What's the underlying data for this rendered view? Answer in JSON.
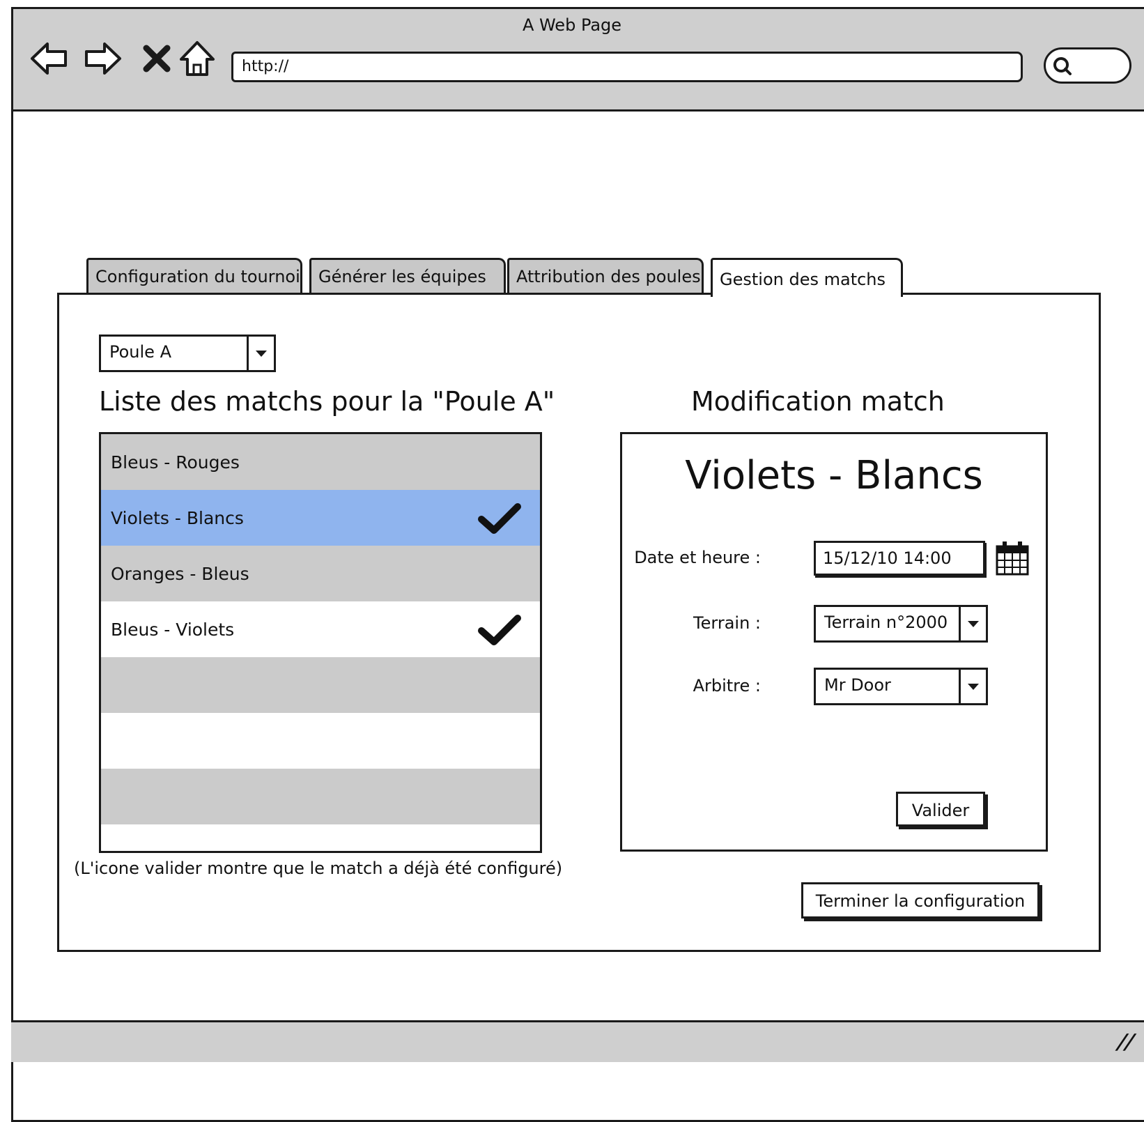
{
  "window": {
    "title": "A Web Page"
  },
  "browser": {
    "url": "http://"
  },
  "tabs": [
    {
      "label": "Configuration du tournoi",
      "active": false
    },
    {
      "label": "Générer les équipes",
      "active": false
    },
    {
      "label": "Attribution des poules",
      "active": false
    },
    {
      "label": "Gestion des matchs",
      "active": true
    }
  ],
  "pool_select": {
    "value": "Poule A"
  },
  "match_list": {
    "heading": "Liste des matchs pour la \"Poule A\"",
    "items": [
      {
        "label": "Bleus - Rouges",
        "configured": false,
        "selected": false
      },
      {
        "label": "Violets - Blancs",
        "configured": true,
        "selected": true
      },
      {
        "label": "Oranges  -  Bleus",
        "configured": false,
        "selected": false
      },
      {
        "label": "Bleus - Violets",
        "configured": true,
        "selected": false
      },
      {
        "label": "",
        "configured": false,
        "selected": false
      },
      {
        "label": "",
        "configured": false,
        "selected": false
      },
      {
        "label": "",
        "configured": false,
        "selected": false
      },
      {
        "label": "",
        "configured": false,
        "selected": false
      }
    ],
    "note": "(L'icone valider montre que le match a déjà été configuré)"
  },
  "edit": {
    "heading": "Modification match",
    "match_title": "Violets - Blancs",
    "date_label": "Date et heure :",
    "date_value": "15/12/10 14:00",
    "terrain_label": "Terrain :",
    "terrain_value": "Terrain n°2000",
    "arbitre_label": "Arbitre :",
    "arbitre_value": "Mr Door",
    "validate_label": "Valider"
  },
  "finish_label": "Terminer la configuration",
  "colors": {
    "chrome": "#cfcfcf",
    "selected_row": "#8fb4ee",
    "grey_row": "#cbcbcb"
  }
}
